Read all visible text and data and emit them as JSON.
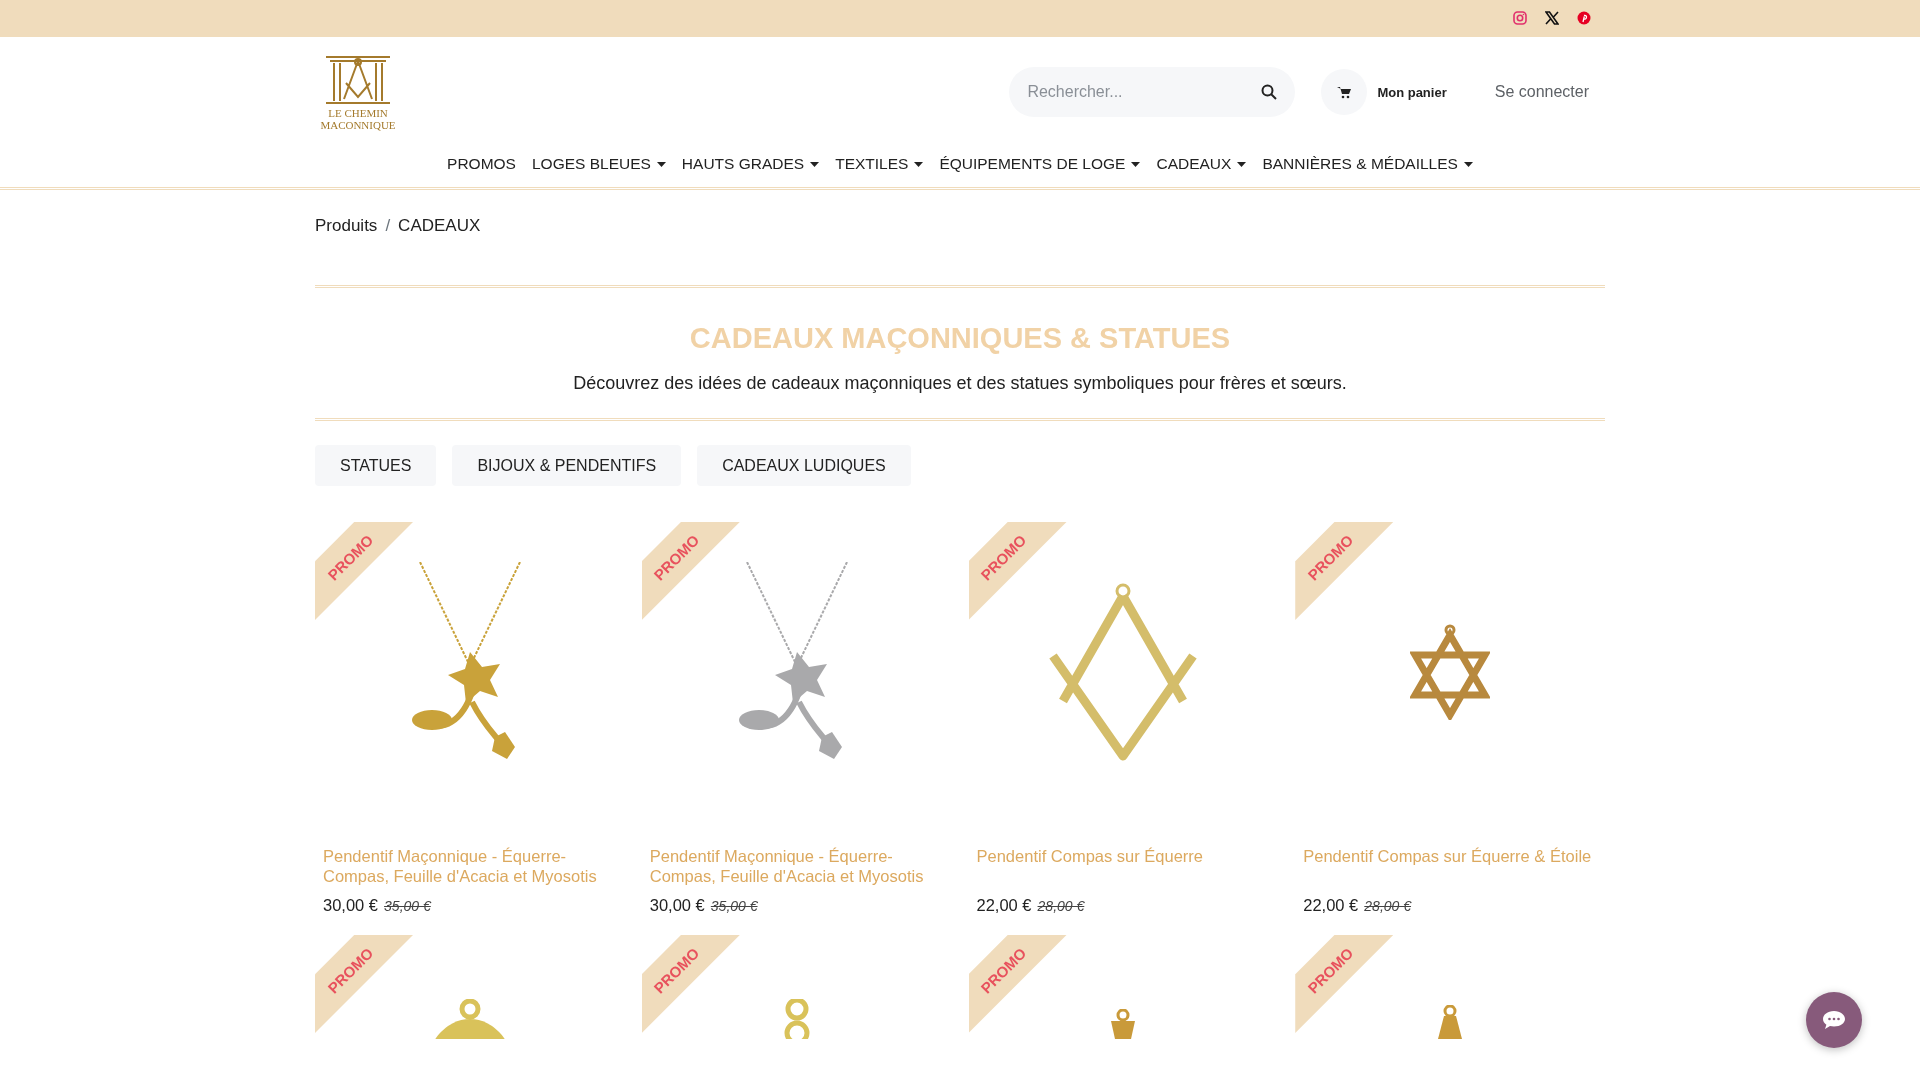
{
  "top_bar": {
    "social": [
      {
        "kind": "instagram",
        "color": "#e1306c"
      },
      {
        "kind": "x",
        "color": "#111111"
      },
      {
        "kind": "pinterest",
        "color": "#e60023"
      }
    ]
  },
  "logo": {
    "lines": [
      "LE CHEMIN",
      "MACONNIQUE"
    ]
  },
  "search": {
    "placeholder": "Rechercher..."
  },
  "cart": {
    "label": "Mon panier"
  },
  "login": {
    "label": "Se connecter"
  },
  "nav": [
    {
      "label": "PROMOS",
      "dropdown": false
    },
    {
      "label": "LOGES BLEUES",
      "dropdown": true
    },
    {
      "label": "HAUTS GRADES",
      "dropdown": true
    },
    {
      "label": "TEXTILES",
      "dropdown": true
    },
    {
      "label": "ÉQUIPEMENTS DE LOGE",
      "dropdown": true
    },
    {
      "label": "CADEAUX",
      "dropdown": true
    },
    {
      "label": "BANNIÈRES & MÉDAILLES",
      "dropdown": true
    }
  ],
  "breadcrumb": [
    "Produits",
    "CADEAUX"
  ],
  "breadcrumb_separator": "/",
  "heading": {
    "title": "CADEAUX MAÇONNIQUES & STATUES",
    "subtitle": "Découvrez des idées de cadeaux maçonniques et des statues symboliques pour frères et sœurs."
  },
  "filters": [
    "STATUES",
    "BIJOUX & PENDENTIFS",
    "CADEAUX LUDIQUES"
  ],
  "products": [
    {
      "promo": "PROMO",
      "kind": "flower",
      "color": "#c9a23a",
      "name": "Pendentif Maçonnique - Équerre-Compas, Feuille d'Acacia et Myosotis",
      "price": "30,00 €",
      "old_price": "35,00 €"
    },
    {
      "promo": "PROMO",
      "kind": "flower",
      "color": "#a9a9ab",
      "name": "Pendentif Maçonnique - Équerre-Compas, Feuille d'Acacia et Myosotis",
      "price": "30,00 €",
      "old_price": "35,00 €"
    },
    {
      "promo": "PROMO",
      "kind": "compass",
      "color": "#d4bd6a",
      "name": "Pendentif Compas sur Équerre",
      "price": "22,00 €",
      "old_price": "28,00 €"
    },
    {
      "promo": "PROMO",
      "kind": "star",
      "color": "#b8893e",
      "name": "Pendentif Compas sur Équerre & Étoile",
      "price": "22,00 €",
      "old_price": "28,00 €"
    },
    {
      "promo": "PROMO",
      "kind": "medal",
      "color": "#d9c25a"
    },
    {
      "promo": "PROMO",
      "kind": "ring",
      "color": "#d9c25a"
    },
    {
      "promo": "PROMO",
      "kind": "medal-small",
      "color": "#c99a3a"
    },
    {
      "promo": "PROMO",
      "kind": "drop",
      "color": "#c99a3a"
    }
  ]
}
